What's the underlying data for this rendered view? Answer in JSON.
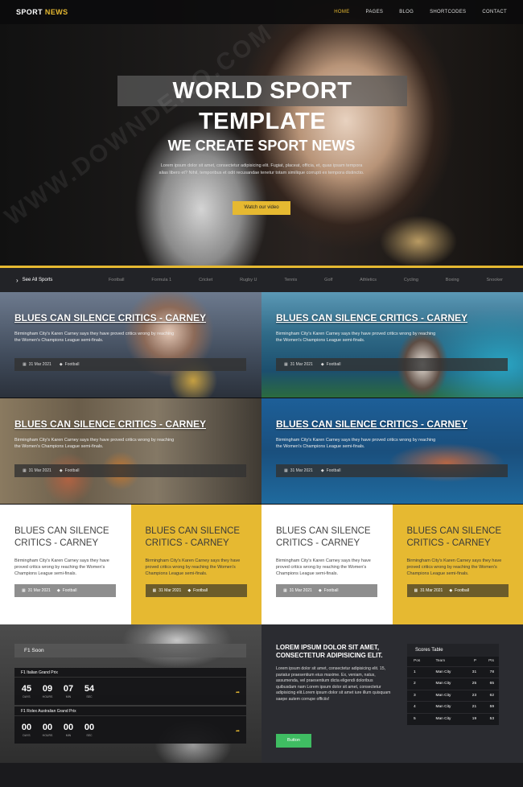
{
  "header": {
    "logo_a": "SPORT",
    "logo_b": "NEWS",
    "nav": [
      "HOME",
      "PAGES",
      "BLOG",
      "SHORTCODES",
      "CONTACT"
    ]
  },
  "hero": {
    "title": "WORLD SPORT TEMPLATE",
    "subtitle": "WE CREATE SPORT NEWS",
    "text": "Lorem ipsum dolor sit amet, consectetur adipisicing elit. Fugiat, placeat, officia, et, quas ipsam tempora alias libero et? Nihil, temporibus et odit recusandae tenetur totam similique corrupti ex tempora distinctio.",
    "button": "Watch our video"
  },
  "sportsbar": {
    "see_all": "See All Sports",
    "cats": [
      "Football",
      "Formula 1",
      "Cricket",
      "Rugby U",
      "Tennis",
      "Golf",
      "Athletics",
      "Cycling",
      "Boxing",
      "Snooker"
    ]
  },
  "features": [
    {
      "title": "BLUES CAN SILENCE CRITICS - CARNEY",
      "text": "Birmingham City's Karen Carney says they have proved critics wrong by reaching the Women's Champions League semi-finals.",
      "date": "31 Mar 2021",
      "tag": "Football"
    },
    {
      "title": "BLUES CAN SILENCE CRITICS - CARNEY",
      "text": "Birmingham City's Karen Carney says they have proved critics wrong by reaching the Women's Champions League semi-finals.",
      "date": "31 Mar 2021",
      "tag": "Football"
    },
    {
      "title": "BLUES CAN SILENCE CRITICS - CARNEY",
      "text": "Birmingham City's Karen Carney says they have proved critics wrong by reaching the Women's Champions League semi-finals.",
      "date": "31 Mar 2021",
      "tag": "Football"
    },
    {
      "title": "BLUES CAN SILENCE CRITICS - CARNEY",
      "text": "Birmingham City's Karen Carney says they have proved critics wrong by reaching the Women's Champions League semi-finals.",
      "date": "31 Mar 2021",
      "tag": "Football"
    }
  ],
  "small": [
    {
      "title": "BLUES CAN SILENCE CRITICS - CARNEY",
      "text": "Birmingham City's Karen Carney says they have proved critics wrong by reaching the Women's Champions League semi-finals.",
      "date": "31 Mar 2021",
      "tag": "Football"
    },
    {
      "title": "BLUES CAN SILENCE CRITICS - CARNEY",
      "text": "Birmingham City's Karen Carney says they have proved critics wrong by reaching the Women's Champions League semi-finals.",
      "date": "31 Mar 2021",
      "tag": "Football"
    },
    {
      "title": "BLUES CAN SILENCE CRITICS - CARNEY",
      "text": "Birmingham City's Karen Carney says they have proved critics wrong by reaching the Women's Champions League semi-finals.",
      "date": "31 Mar 2021",
      "tag": "Football"
    },
    {
      "title": "BLUES CAN SILENCE CRITICS - CARNEY",
      "text": "Birmingham City's Karen Carney says they have proved critics wrong by reaching the Women's Champions League semi-finals.",
      "date": "31 Mar 2021",
      "tag": "Football"
    }
  ],
  "f1": {
    "title": "F1 Soon",
    "races": [
      {
        "name": "F1 Italian Grand Prix",
        "days": "45",
        "hours": "09",
        "min": "07",
        "sec": "54"
      },
      {
        "name": "F1 Rolex Australian Grand Prix",
        "days": "00",
        "hours": "00",
        "min": "00",
        "sec": "00"
      }
    ],
    "labels": {
      "days": "DAYS",
      "hours": "HOURS",
      "min": "MIN",
      "sec": "SEC"
    }
  },
  "lorem": {
    "title": "LOREM IPSUM DOLOR SIT AMET, CONSECTETUR ADIPISICING ELIT.",
    "text": "Lorem ipsum dolor sit amet, consectetur adipisicing elit. 15, pariatur praesentium eius maxime. Ex, veniam, natus, assumenda, vel praesentium dicta eligendi doloribus quibusdam nam Lorem ipsum dolor sit amet, consectetur adipisicing elit.Lorem ipsum dolor sit amet iure illum quisquam saepe autem corrupe officiis!",
    "button": "Button"
  },
  "scores": {
    "title": "Scores Table",
    "headers": [
      "Pos",
      "Team",
      "P",
      "Pts"
    ],
    "rows": [
      [
        "1",
        "Man City",
        "31",
        "78"
      ],
      [
        "2",
        "Man City",
        "25",
        "65"
      ],
      [
        "3",
        "Man City",
        "23",
        "62"
      ],
      [
        "4",
        "Man City",
        "21",
        "59"
      ],
      [
        "5",
        "Man City",
        "19",
        "53"
      ]
    ]
  },
  "watermark": "WWW.DOWNDEMO.COM",
  "colors": {
    "accent": "#e6b931",
    "button_green": "#3fbd62"
  }
}
